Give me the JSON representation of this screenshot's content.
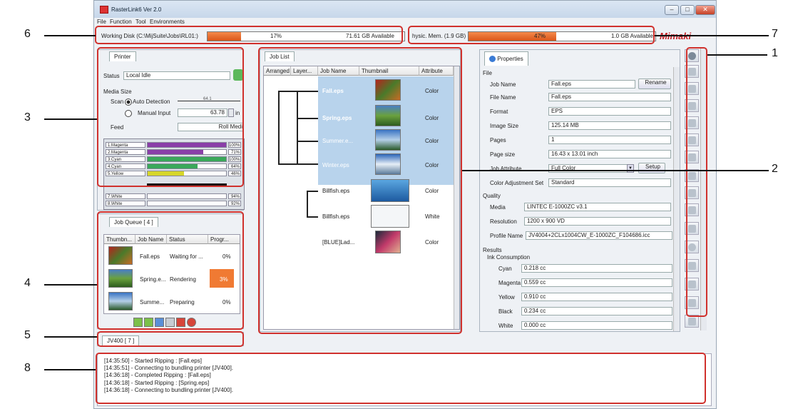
{
  "window": {
    "title": "RasterLink6 Ver 2.0"
  },
  "menu": [
    "File",
    "Function",
    "Tool",
    "Environments"
  ],
  "status_bar": {
    "working_disk_label": "Working Disk (C:\\MijSuite\\Jobs\\RL01:)",
    "working_disk_percent_text": "17%",
    "working_disk_percent": 17,
    "working_disk_available": "71.61 GB Available",
    "phys_mem_label": "hysic. Mem. (1.9 GB)",
    "phys_mem_percent_text": "47%",
    "phys_mem_percent": 47,
    "phys_mem_available": "1.0 GB Available",
    "brand": "Mimaki"
  },
  "printer_panel": {
    "tab": "Printer",
    "status_label": "Status",
    "status_value": "Local Idle",
    "media_size_label": "Media Size",
    "scan_label": "Scan",
    "auto_detection_label": "Auto Detection",
    "auto_ruler_text": "64.1",
    "manual_input_label": "Manual Input",
    "manual_value": "63.78",
    "unit": "in",
    "feed_label": "Feed",
    "feed_value": "Roll Medi",
    "inks": [
      {
        "name": "1.Magenta",
        "level": 100,
        "pct": "100%",
        "color": "#8a3fa8"
      },
      {
        "name": "2.Magenta",
        "level": 71,
        "pct": "71%",
        "color": "#8a3fa8"
      },
      {
        "name": "3.Cyan",
        "level": 100,
        "pct": "100%",
        "color": "#3aa85a"
      },
      {
        "name": "4.Cyan",
        "level": 64,
        "pct": "64%",
        "color": "#3aa85a"
      },
      {
        "name": "5.Yellow",
        "level": 46,
        "pct": "46%",
        "color": "#d6d62a"
      },
      {
        "name": "7.White",
        "level": 94,
        "pct": "94%",
        "color": "#ffffff"
      },
      {
        "name": "8.White",
        "level": 92,
        "pct": "92%",
        "color": "#ffffff"
      }
    ]
  },
  "job_queue": {
    "tab": "Job Queue [ 4 ]",
    "headers": [
      "Thumbn...",
      "Job Name",
      "Status",
      "Progr..."
    ],
    "rows": [
      {
        "name": "Fall.eps",
        "status": "Waiting for ...",
        "progress": "0%"
      },
      {
        "name": "Spring.e...",
        "status": "Rendering",
        "progress": "3%"
      },
      {
        "name": "Summe...",
        "status": "Preparing",
        "progress": "0%"
      }
    ]
  },
  "printer_tab": {
    "label": "JV400 [ 7 ]"
  },
  "job_list": {
    "tab": "Job List",
    "headers": [
      "Arranged",
      "Layer...",
      "Job Name",
      "Thumbnail",
      "Attribute"
    ],
    "rows": [
      {
        "name": "Fall.eps",
        "attribute": "Color"
      },
      {
        "name": "Spring.eps",
        "attribute": "Color"
      },
      {
        "name": "Summer.e...",
        "attribute": "Color"
      },
      {
        "name": "Winter.eps",
        "attribute": "Color"
      },
      {
        "name": "Billfish.eps",
        "attribute": "Color"
      },
      {
        "name": "Billfish.eps",
        "attribute": "White"
      },
      {
        "name": "[BLUE]Lad...",
        "attribute": "Color"
      }
    ]
  },
  "properties": {
    "tab": "Properties",
    "file_section": "File",
    "job_name_label": "Job Name",
    "job_name": "Fall.eps",
    "rename_button": "Rename",
    "file_name_label": "File Name",
    "file_name": "Fall.eps",
    "format_label": "Format",
    "format": "EPS",
    "image_size_label": "Image Size",
    "image_size": "125.14 MB",
    "pages_label": "Pages",
    "pages": "1",
    "page_size_label": "Page size",
    "page_size": "16.43 x 13.01 inch",
    "job_attribute_label": "Job Attribute",
    "job_attribute": "Full Color",
    "setup_button": "Setup",
    "color_adjustment_label": "Color Adjustment Set",
    "color_adjustment": "Standard",
    "quality_section": "Quality",
    "media_label": "Media",
    "media": "LINTEC E-1000ZC v3.1",
    "resolution_label": "Resolution",
    "resolution": "1200 x 900 VD",
    "profile_label": "Profile Name",
    "profile": "JV4004+2CLx1004CW_E-1000ZC_F104686.icc",
    "results_section": "Results",
    "ink_consumption_label": "Ink Consumption",
    "consumption": [
      {
        "label": "Cyan",
        "value": "0.218 cc"
      },
      {
        "label": "Magenta",
        "value": "0.559 cc"
      },
      {
        "label": "Yellow",
        "value": "0.910 cc"
      },
      {
        "label": "Black",
        "value": "0.234 cc"
      },
      {
        "label": "White",
        "value": "0.000 cc"
      }
    ]
  },
  "log": [
    "[14:35:50] - Started Ripping : [Fall.eps]",
    "[14:35:51] - Connecting to bundling printer [JV400].",
    "[14:36:18] - Completed Ripping : [Fall.eps]",
    "[14:36:18] - Started Ripping : [Spring.eps]",
    "[14:36:18] - Connecting to bundling printer [JV400]."
  ],
  "callouts": [
    "1",
    "2",
    "3",
    "4",
    "5",
    "6",
    "7",
    "8"
  ]
}
